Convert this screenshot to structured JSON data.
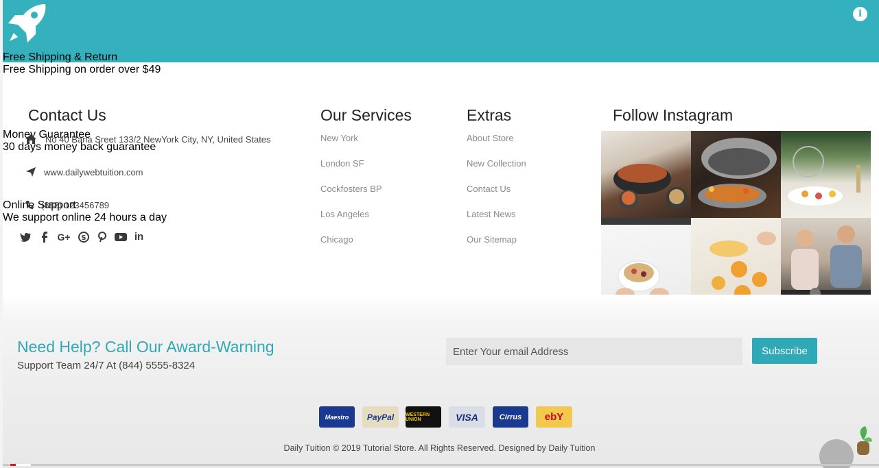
{
  "features": [
    {
      "icon": "rocket-icon",
      "title": "Free Shipping & Return",
      "subtitle": "Free Shipping on order over $49"
    },
    {
      "icon": "money-hand-icon",
      "title": "Money Guarantee",
      "subtitle": "30 days money back guarantee"
    },
    {
      "icon": "headphones-icon",
      "title": "Online Support",
      "subtitle": "We support online 24 hours a day"
    }
  ],
  "info_icon": "i",
  "contact": {
    "title": "Contact Us",
    "address": "No 40 Baria Sreet 133/2 NewYork City, NY, United States",
    "website": "www.dailywebtuition.com",
    "phone": "(888) 123456789",
    "social_icons": [
      "twitter-icon",
      "facebook-icon",
      "google-plus-icon",
      "skype-icon",
      "pinterest-icon",
      "youtube-icon",
      "linkedin-icon"
    ]
  },
  "services": {
    "title": "Our Services",
    "items": [
      "New York",
      "London SF",
      "Cockfosters BP",
      "Los Angeles",
      "Chicago"
    ]
  },
  "extras": {
    "title": "Extras",
    "items": [
      "About Store",
      "New Collection",
      "Contact Us",
      "Latest News",
      "Our Sitemap"
    ]
  },
  "instagram": {
    "title": "Follow Instagram"
  },
  "help": {
    "title": "Need Help? Call Our Award-Warning",
    "subtitle": "Support Team 24/7 At (844) 5555-8324"
  },
  "newsletter": {
    "placeholder": "Enter Your email Address",
    "button": "Subscribe"
  },
  "payments": [
    "Maestro",
    "PayPal",
    "WESTERN UNION",
    "VISA",
    "Cirrus",
    "ebY"
  ],
  "copyright": "Daily Tuition © 2019 Tutorial Store. All Rights Reserved. Designed by Daily Tuition",
  "colors": {
    "accent": "#35b1bd",
    "accent_text": "#2ea9b5"
  }
}
